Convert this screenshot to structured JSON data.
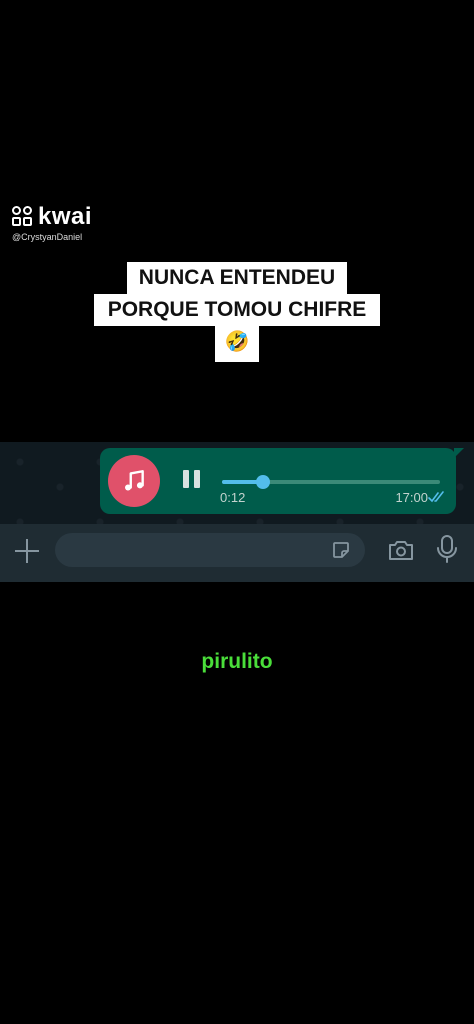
{
  "watermark": {
    "brand": "kwai",
    "handle": "@CrystyanDaniel"
  },
  "caption": {
    "line1": "NUNCA ENTENDEU",
    "line2": "PORQUE TOMOU CHIFRE",
    "emoji": "🤣"
  },
  "voice_message": {
    "icon": "music-note-icon",
    "elapsed": "0:12",
    "time": "17:00",
    "progress": 0.19,
    "status_icon": "double-check-icon",
    "colors": {
      "bubble": "#005c4b",
      "avatar": "#e0516a",
      "accent": "#53bdeb"
    }
  },
  "composer": {
    "attach_icon": "plus-icon",
    "sticker_icon": "sticker-icon",
    "camera_icon": "camera-icon",
    "mic_icon": "microphone-icon"
  },
  "subtitle": {
    "text": "pirulito",
    "color": "#4ade3a"
  }
}
